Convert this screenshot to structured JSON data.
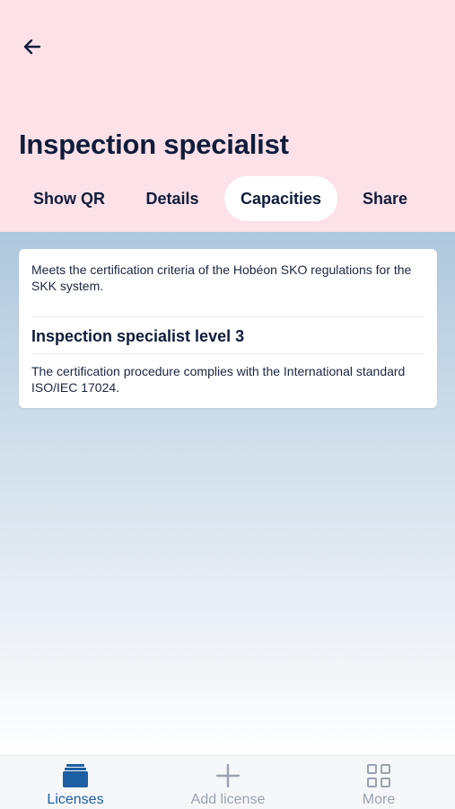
{
  "header": {
    "title": "Inspection specialist",
    "back_icon": "arrow-left-icon",
    "background_color": "#fde1e8"
  },
  "tabs": [
    {
      "label": "Show QR",
      "active": false
    },
    {
      "label": "Details",
      "active": false
    },
    {
      "label": "Capacities",
      "active": true
    },
    {
      "label": "Share",
      "active": false
    }
  ],
  "card": {
    "intro": "Meets the certification criteria of the Hobéon SKO regulations for the SKK system.",
    "heading": "Inspection specialist level 3",
    "note": "The certification procedure complies with the International standard ISO/IEC 17024."
  },
  "bottom_nav": [
    {
      "label": "Licenses",
      "icon": "licenses-stack-icon",
      "active": true
    },
    {
      "label": "Add license",
      "icon": "plus-icon",
      "active": false
    },
    {
      "label": "More",
      "icon": "grid-icon",
      "active": false
    }
  ],
  "colors": {
    "accent": "#1c5fa3",
    "text_dark": "#0f1d3a",
    "inactive": "#9aa3b0"
  }
}
